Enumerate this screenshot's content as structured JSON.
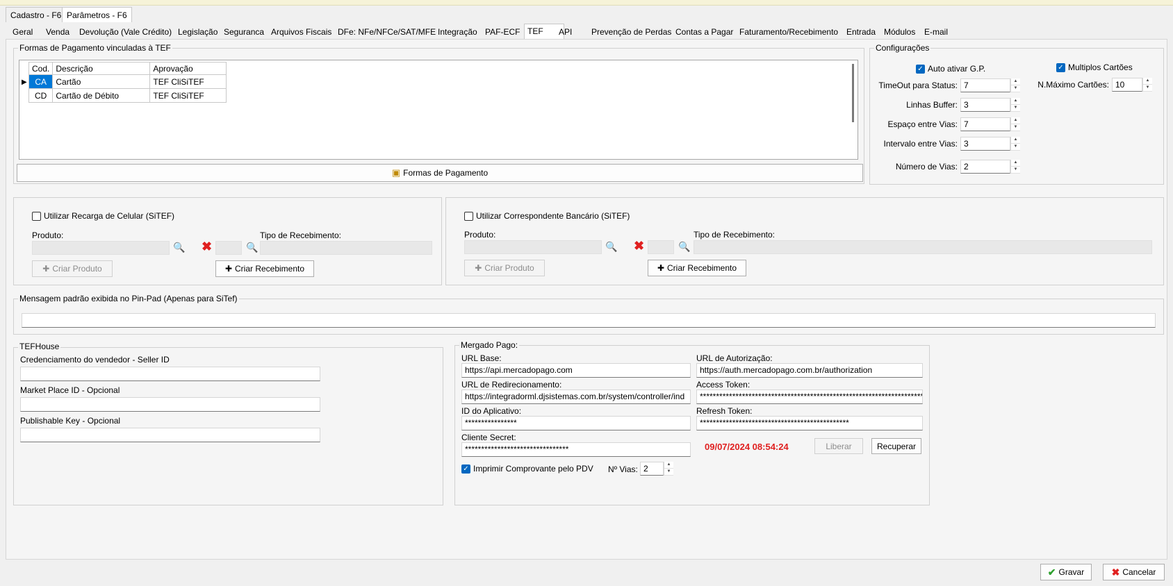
{
  "outer_tabs": [
    "Cadastro - F6",
    "Parâmetros - F6"
  ],
  "inner_tabs": [
    "Geral",
    "Venda",
    "Devolução (Vale Crédito)",
    "Legislação",
    "Seguranca",
    "Arquivos Fiscais",
    "DFe: NFe/NFCe/SAT/MFE",
    "Integração",
    "PAF-ECF",
    "TEF",
    "API",
    "Prevenção de Perdas",
    "Contas a Pagar",
    "Faturamento/Recebimento",
    "Entrada",
    "Módulos",
    "E-mail"
  ],
  "active_inner_tab": "TEF",
  "formas": {
    "group_label": "Formas de Pagamento vinculadas à TEF",
    "columns": [
      "Cod.",
      "Descrição",
      "Aprovação"
    ],
    "rows": [
      [
        "CA",
        "Cartão",
        "TEF CliSiTEF"
      ],
      [
        "CD",
        "Cartão de Débito",
        "TEF CliSiTEF"
      ]
    ],
    "button_label": "Formas de Pagamento"
  },
  "config": {
    "group_label": "Configurações",
    "auto_ativar_label": "Auto ativar G.P.",
    "multiplos_label": "Multiplos Cartões",
    "timeout_label": "TimeOut para Status:",
    "timeout_value": "7",
    "linhas_label": "Linhas Buffer:",
    "linhas_value": "3",
    "espaco_label": "Espaço entre Vias:",
    "espaco_value": "7",
    "intervalo_label": "Intervalo entre Vias:",
    "intervalo_value": "3",
    "numero_label": "Número de Vias:",
    "numero_value": "2",
    "nmax_label": "N.Máximo Cartões:",
    "nmax_value": "10"
  },
  "recarga": {
    "checkbox_label": "Utilizar Recarga de Celular (SiTEF)",
    "produto_label": "Produto:",
    "tipo_label": "Tipo de Recebimento:",
    "criar_produto": "Criar Produto",
    "criar_recebimento": "Criar Recebimento"
  },
  "correspondente": {
    "checkbox_label": "Utilizar Correspondente Bancário (SiTEF)",
    "produto_label": "Produto:",
    "tipo_label": "Tipo de Recebimento:",
    "criar_produto": "Criar Produto",
    "criar_recebimento": "Criar Recebimento"
  },
  "mensagem": {
    "group_label": "Mensagem padrão exibida no Pin-Pad (Apenas para SiTef)",
    "value": ""
  },
  "tefhouse": {
    "group_label": "TEFHouse",
    "seller_label": "Credenciamento do vendedor - Seller ID",
    "market_label": "Market Place ID - Opcional",
    "publishable_label": "Publishable Key - Opcional"
  },
  "mercado": {
    "group_label": "Mergado Pago:",
    "url_base_label": "URL Base:",
    "url_base_value": "https://api.mercadopago.com",
    "url_auth_label": "URL de Autorização:",
    "url_auth_value": "https://auth.mercadopago.com.br/authorization",
    "url_redir_label": "URL de Redirecionamento:",
    "url_redir_value": "https://integradorml.djsistemas.com.br/system/controller/ind",
    "access_label": "Access Token:",
    "access_value": "************************************************************************",
    "app_id_label": "ID do Aplicativo:",
    "app_id_value": "****************",
    "refresh_label": "Refresh Token:",
    "refresh_value": "**********************************************",
    "secret_label": "Cliente Secret:",
    "secret_value": "********************************",
    "date": "09/07/2024 08:54:24",
    "liberar": "Liberar",
    "recuperar": "Recuperar",
    "imprimir_label": "Imprimir Comprovante pelo PDV",
    "vias_label": "Nº Vias:",
    "vias_value": "2"
  },
  "footer": {
    "gravar": "Gravar",
    "cancelar": "Cancelar"
  }
}
